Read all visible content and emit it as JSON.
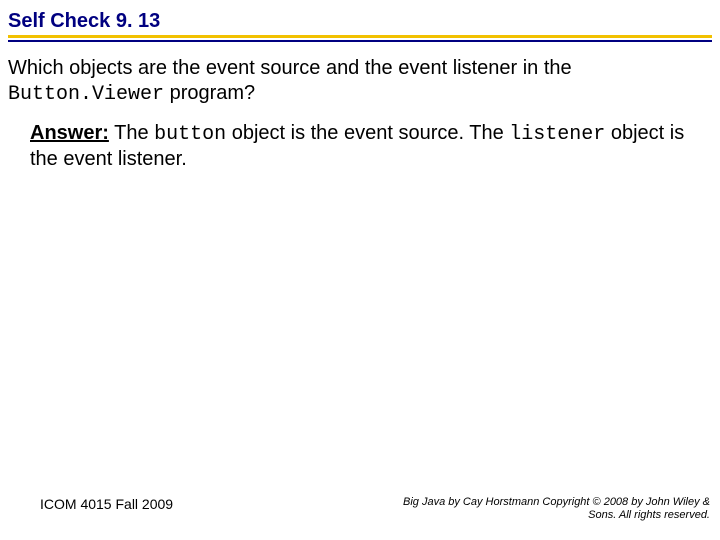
{
  "header": {
    "title": "Self Check 9. 13"
  },
  "question": {
    "line1": "Which objects are the event source and the event listener in the ",
    "code1": "Button.Viewer",
    "line2": " program?"
  },
  "answer": {
    "label": "Answer:",
    "t1": " The ",
    "code1": "button",
    "t2": " object is the event source. The ",
    "code2": "listener",
    "t3": " object is the event listener."
  },
  "footer": {
    "left": "ICOM 4015 Fall 2009",
    "right": "Big Java by Cay Horstmann Copyright © 2008 by John Wiley & Sons. All rights reserved."
  }
}
